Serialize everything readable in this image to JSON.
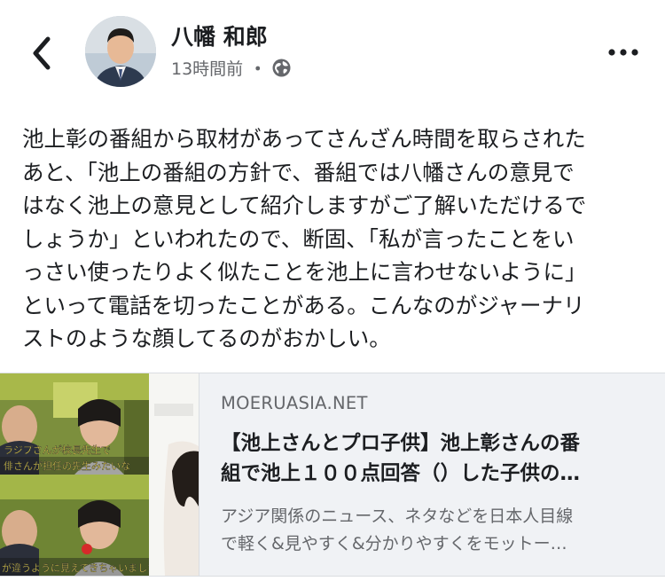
{
  "post": {
    "author": "八幡 和郎",
    "time": "13時間前",
    "separator": "・",
    "privacy_icon": "globe-icon",
    "back_icon": "chevron-left-icon",
    "more_icon": "more-horizontal-icon",
    "text": "池上彰の番組から取材があってさんざん時間を取らされた\nあと、「池上の番組の方針で、番組では八幡さんの意見で\nはなく池上の意見として紹介しますがご了解いただけるで\nしょうか」といわれたので、断固、「私が言ったことをい\nっさい使ったりよく似たことを池上に言わせないように」\nといって電話を切ったことがある。こんなのがジャーナリ\nストのような顔してるのがおかしい。"
  },
  "link_card": {
    "domain": "MOERUASIA.NET",
    "title_line1": "【池上さんとプロ子供】池上彰さんの番",
    "title_line2": "組で池上１００点回答（）した子供の…",
    "desc_line1": "アジア関係のニュース、ネタなどを日本人目線",
    "desc_line2": "で軽く&見やすく&分かりやすくをモットー…",
    "thumbnail_caption_top": "ラジプさんが校長先生で",
    "thumbnail_caption_top2": "俳さんが担任の先生みたいな",
    "thumbnail_caption_bottom": "が違うように見えてきちゃいました"
  },
  "colors": {
    "text": "#1c1e21",
    "secondary": "#65676b",
    "card_bg": "#f0f2f5",
    "border": "#dadde1"
  }
}
